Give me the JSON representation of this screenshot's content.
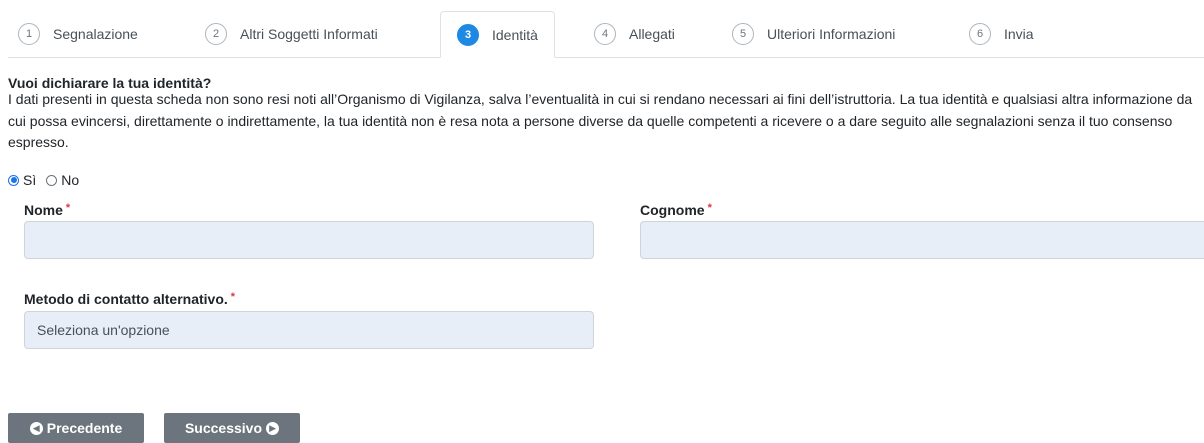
{
  "tabs": [
    {
      "num": "1",
      "label": "Segnalazione",
      "active": false
    },
    {
      "num": "2",
      "label": "Altri Soggetti Informati",
      "active": false
    },
    {
      "num": "3",
      "label": "Identità",
      "active": true
    },
    {
      "num": "4",
      "label": "Allegati",
      "active": false
    },
    {
      "num": "5",
      "label": "Ulteriori Informazioni",
      "active": false
    },
    {
      "num": "6",
      "label": "Invia",
      "active": false
    }
  ],
  "identity": {
    "question": "Vuoi dichiarare la tua identità?",
    "description": "I dati presenti in questa scheda non sono resi noti all’Organismo di Vigilanza, salva l’eventualità in cui si rendano necessari ai fini dell’istruttoria. La tua identità e qualsiasi altra informazione da cui possa evincersi, direttamente o indirettamente, la tua identità non è resa nota a persone diverse da quelle competenti a ricevere o a dare seguito alle segnalazioni senza il tuo consenso espresso.",
    "options": [
      {
        "label": "Sì",
        "checked": true
      },
      {
        "label": "No",
        "checked": false
      }
    ]
  },
  "form": {
    "nome_label": "Nome",
    "nome_value": "",
    "cognome_label": "Cognome",
    "cognome_value": "",
    "contact_label": "Metodo di contatto alternativo.",
    "contact_selected": "Seleziona un'opzione",
    "required_mark": "*"
  },
  "nav": {
    "prev_label": "Precedente",
    "next_label": "Successivo"
  },
  "colors": {
    "accent": "#1e88e5",
    "button_bg": "#6c757d",
    "input_bg": "#e8eef7",
    "required": "#dc3545"
  },
  "icons": {
    "prev": "arrow-circle-left-icon",
    "next": "arrow-circle-right-icon"
  }
}
